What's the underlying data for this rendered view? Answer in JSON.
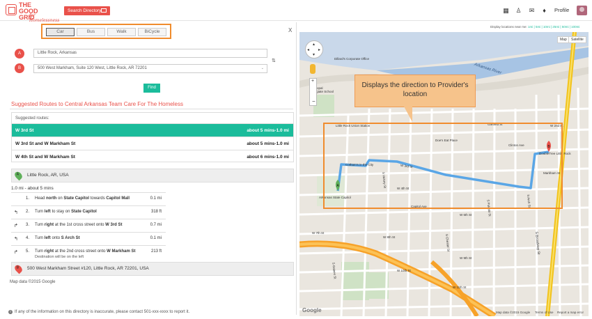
{
  "header": {
    "logo_line1": "THE GOOD",
    "logo_line2": "GRID",
    "logo_tagline": "for Homelessness",
    "search_button": "Search Directory",
    "profile_label": "Profile"
  },
  "modes": [
    "Car",
    "Bus",
    "Walk",
    "BiCycle"
  ],
  "active_mode": "Car",
  "close_label": "X",
  "origin": {
    "pin": "A",
    "value": "Little Rock, Arkansas"
  },
  "destination": {
    "pin": "B",
    "value": "500 West Markham, Suite 120 West, Little Rock, AR 72201"
  },
  "find_label": "Find",
  "suggested_title": "Suggested Routes to Central Arkansas Team Care For The Homeless",
  "routes_header": "Suggested routes:",
  "routes": [
    {
      "name": "W 3rd St",
      "info": "about 5 mins-1.0 mi"
    },
    {
      "name": "W 3rd St and W Markham St",
      "info": "about 5 mins-1.0 mi"
    },
    {
      "name": "W 4th St and W Markham St",
      "info": "about 6 mins-1.0 mi"
    }
  ],
  "start_point": {
    "pin": "A",
    "label": "Little Rock, AR, USA"
  },
  "summary": "1.0 mi - about 5 mins",
  "steps": [
    {
      "arrow": "",
      "num": "1.",
      "pre": "Head ",
      "b1": "north",
      "mid": " on ",
      "b2": "State Capitol",
      "mid2": " towards ",
      "b3": "Capitol Mall",
      "sub": "",
      "dist": "0.1 mi"
    },
    {
      "arrow": "↰",
      "num": "2.",
      "pre": "Turn ",
      "b1": "left",
      "mid": " to stay on ",
      "b2": "State Capitol",
      "mid2": "",
      "b3": "",
      "sub": "",
      "dist": "318 ft"
    },
    {
      "arrow": "↱",
      "num": "3.",
      "pre": "Turn ",
      "b1": "right",
      "mid": " at the 1st cross street onto ",
      "b2": "W 3rd St",
      "mid2": "",
      "b3": "",
      "sub": "",
      "dist": "0.7 mi"
    },
    {
      "arrow": "↰",
      "num": "4.",
      "pre": "Turn ",
      "b1": "left",
      "mid": " onto ",
      "b2": "S Arch St",
      "mid2": "",
      "b3": "",
      "sub": "",
      "dist": "0.1 mi"
    },
    {
      "arrow": "↱",
      "num": "5.",
      "pre": "Turn ",
      "b1": "right",
      "mid": " at the 2nd cross street onto ",
      "b2": "W Markham St",
      "mid2": "",
      "b3": "",
      "sub": "Destination will be on the left",
      "dist": "213 ft"
    }
  ],
  "end_point": {
    "pin": "B",
    "label": "500 West Markham Street #120, Little Rock, AR 72201, USA"
  },
  "map_data_label": "Map data ©2015 Google",
  "footnote": "If any of the information on this directory is inaccurate, please contact 501-xxx-xxxx to report it.",
  "map": {
    "locations_label": "Display locations near me:",
    "radius_options": "1mi | 5mi | 10mi | 25mi | 50mi | 100mi",
    "map_btn": "Map",
    "satellite_btn": "Satellite",
    "callout": "Displays the direction to Provider's location",
    "footer": [
      "Map data ©2015 Google",
      "Terms of Use",
      "Report a map error"
    ],
    "google": "Google",
    "labels": [
      "Dillard's Corporate Office",
      "Arkansas River",
      "Episcopal Collegiate School",
      "Little Rock Union Station",
      "Garland St",
      "Doe's Eat Place",
      "Clinton Ave",
      "W 3rd St",
      "Cotham's in the City",
      "W 4th St",
      "Arkansas State Capitol",
      "Capitol Ave",
      "W 7th St",
      "W 8th St",
      "W 9th St",
      "W 10th St",
      "W 11th St",
      "S Broadway St",
      "S Chester St",
      "S Arch St",
      "S Pulaski St",
      "S Victory St",
      "DoubleTree Little Rock",
      "W 2nd St",
      "W 6th St",
      "S Gaines St",
      "Markham St"
    ],
    "accent_orange": "#f08c2d",
    "route_color": "#5aa6e6"
  },
  "colors": {
    "brand": "#e9514a",
    "teal": "#1bbc9b"
  }
}
